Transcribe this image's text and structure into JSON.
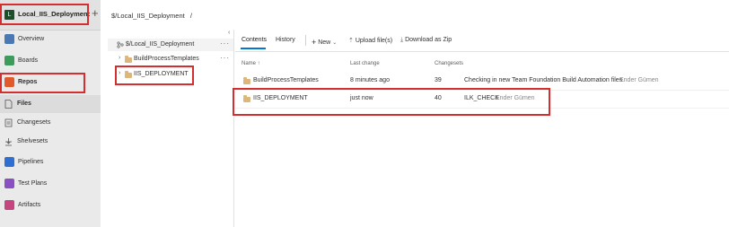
{
  "project": {
    "badge": "L",
    "name": "Local_IIS_Deployment",
    "add": "+"
  },
  "nav": {
    "overview": "Overview",
    "boards": "Boards",
    "repos": "Repos",
    "files": "Files",
    "changesets": "Changesets",
    "shelvesets": "Shelvesets",
    "pipelines": "Pipelines",
    "test_plans": "Test Plans",
    "artifacts": "Artifacts"
  },
  "breadcrumb": {
    "path": "$/Local_IIS_Deployment",
    "sep": "/"
  },
  "tree": {
    "root": "$/Local_IIS_Deployment",
    "items": [
      "BuildProcessTemplates",
      "IIS_DEPLOYMENT"
    ],
    "more": "···"
  },
  "tabs": {
    "contents": "Contents",
    "history": "History"
  },
  "toolbar": {
    "new": "New",
    "upload": "Upload file(s)",
    "download": "Download as Zip"
  },
  "table": {
    "headers": {
      "name": "Name ↑",
      "last_change": "Last change",
      "changesets": "Changesets"
    },
    "rows": [
      {
        "name": "BuildProcessTemplates",
        "last_change": "8 minutes ago",
        "changeset": "39",
        "comment": "Checking in new Team Foundation Build Automation files.",
        "author": "Ender Gümen"
      },
      {
        "name": "IIS_DEPLOYMENT",
        "last_change": "just now",
        "changeset": "40",
        "comment": "ILK_CHECK",
        "author": "Ender Gümen"
      }
    ]
  },
  "colors": {
    "accent": "#0078d4",
    "highlight": "#d32f2f",
    "folder": "#dcb67a"
  }
}
